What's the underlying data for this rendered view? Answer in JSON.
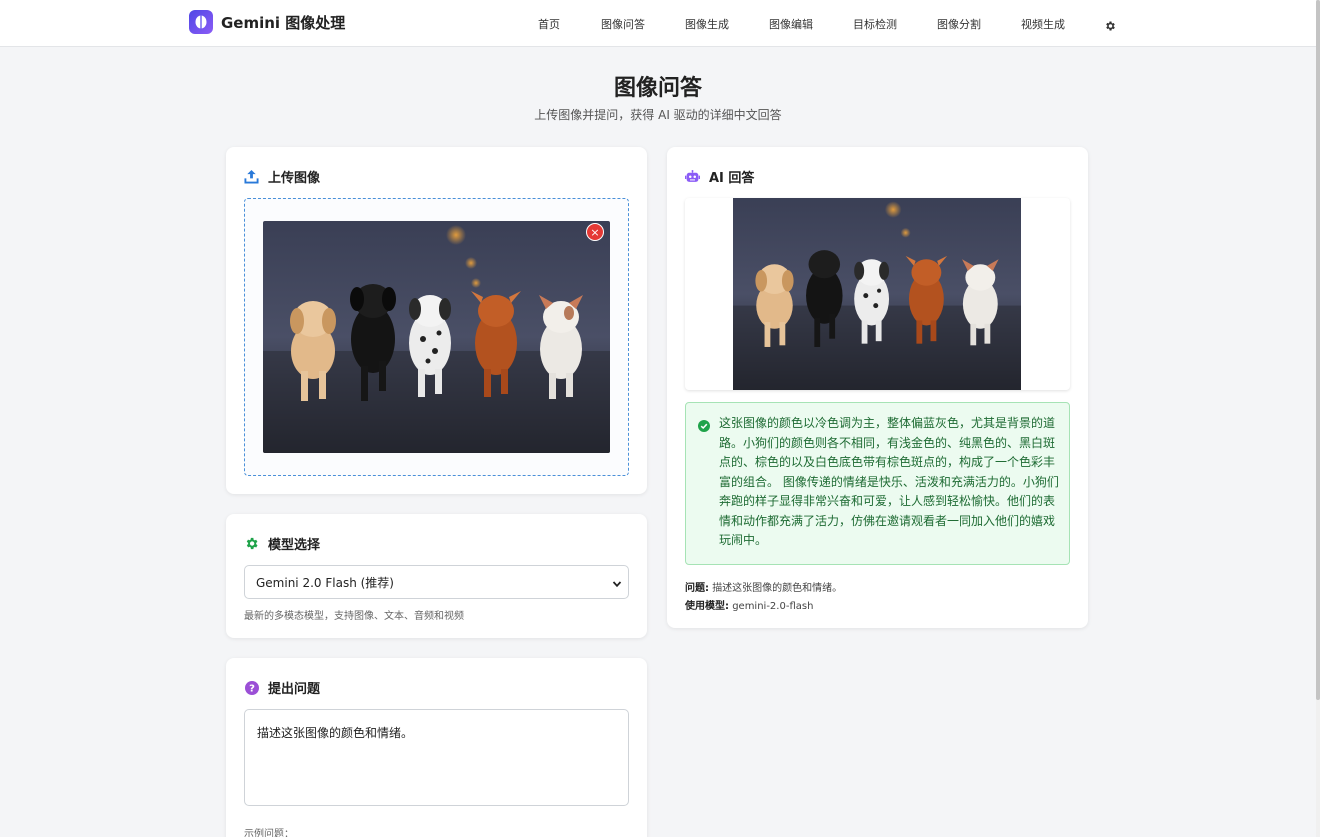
{
  "app": {
    "brand_title": "Gemini 图像处理",
    "nav_items": [
      "首页",
      "图像问答",
      "图像生成",
      "图像编辑",
      "目标检测",
      "图像分割",
      "视频生成"
    ]
  },
  "header": {
    "title": "图像问答",
    "subtitle": "上传图像并提问，获得 AI 驱动的详细中文回答"
  },
  "upload": {
    "title": "上传图像",
    "remove_glyph": "×"
  },
  "model": {
    "title": "模型选择",
    "selected": "Gemini 2.0 Flash (推荐)",
    "description": "最新的多模态模型，支持图像、文本、音频和视频"
  },
  "question": {
    "title": "提出问题",
    "value": "描述这张图像的颜色和情绪。",
    "examples_label": "示例问题："
  },
  "answer": {
    "title": "AI 回答",
    "text": "这张图像的颜色以冷色调为主，整体偏蓝灰色，尤其是背景的道路。小狗们的颜色则各不相同，有浅金色的、纯黑色的、黑白斑点的、棕色的以及白色底色带有棕色斑点的，构成了一个色彩丰富的组合。 图像传递的情绪是快乐、活泼和充满活力的。小狗们奔跑的样子显得非常兴奋和可爱，让人感到轻松愉快。他们的表情和动作都充满了活力，仿佛在邀请观看者一同加入他们的嬉戏玩闹中。",
    "question_label": "问题:",
    "question_value": "描述这张图像的颜色和情绪。",
    "model_label": "使用模型:",
    "model_value": "gemini-2.0-flash"
  },
  "colors": {
    "accent_blue": "#2979d9",
    "success_green": "#1fa34a",
    "question_purple": "#9b4fd6",
    "robot_purple": "#8b5cf6",
    "danger_red": "#e53935"
  },
  "icons": {
    "upload": "upload-icon",
    "model": "gear-icon",
    "question": "question-circle-icon",
    "answer": "robot-icon",
    "success": "check-circle-icon",
    "settings": "gear-icon"
  }
}
